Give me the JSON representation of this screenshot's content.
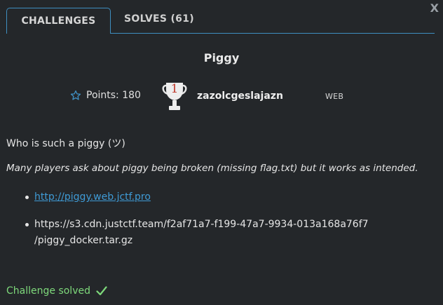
{
  "tabs": {
    "challenges_label": "CHALLENGES",
    "solves_label": "SOLVES (61)"
  },
  "close_label": "X",
  "challenge": {
    "title": "Piggy",
    "points_label": "Points: 180",
    "first_blood_rank": "1",
    "author": "zazolcgeslajazn",
    "tag": "WEB",
    "description": "Who is such a piggy (ツ)",
    "note": "Many players ask about piggy being broken (missing flag.txt) but it works as intended.",
    "links": [
      "http://piggy.web.jctf.pro",
      "https://s3.cdn.justctf.team/f2af71a7-f199-47a7-9934-013a168a76f7/piggy_docker.tar.gz"
    ]
  },
  "status": {
    "text": "Challenge solved"
  },
  "icons": {
    "points": "star-outline-icon",
    "trophy": "trophy-icon",
    "solved": "checkmark-icon"
  },
  "colors": {
    "background": "#24272a",
    "accent": "#3f8fc1",
    "link": "#3f9bd6",
    "success": "#7ed97b",
    "trophy_rank": "#c0392b"
  }
}
